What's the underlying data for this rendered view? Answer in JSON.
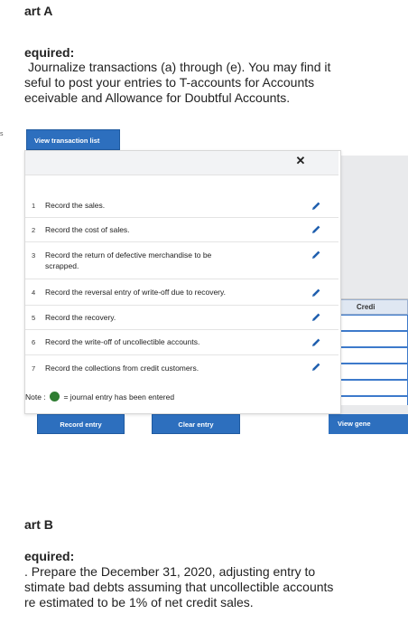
{
  "part_a": {
    "title": "art A",
    "required_label": "equired:",
    "lines": [
      "Journalize transactions (a) through (e). You may find it",
      "seful to post your entries to T-accounts for Accounts",
      "eceivable and Allowance for Doubtful Accounts."
    ]
  },
  "edge_marker": "s",
  "view_transaction_list": "View transaction list",
  "popup": {
    "close_symbol": "✕",
    "transactions": [
      {
        "num": "1",
        "text_lines": [
          "Record the sales."
        ]
      },
      {
        "num": "2",
        "text_lines": [
          "Record the cost of sales."
        ]
      },
      {
        "num": "3",
        "text_lines": [
          "Record the return of defective merchandise to be",
          "scrapped."
        ]
      },
      {
        "num": "4",
        "text_lines": [
          "Record the reversal entry of write-off due to recovery."
        ]
      },
      {
        "num": "5",
        "text_lines": [
          "Record the recovery."
        ]
      },
      {
        "num": "6",
        "text_lines": [
          "Record the write-off of uncollectible accounts."
        ]
      },
      {
        "num": "7",
        "text_lines": [
          "Record the collections from credit customers."
        ]
      }
    ],
    "note_prefix": "Note :",
    "note_suffix": "= journal entry has been entered",
    "record_entry": "Record entry",
    "clear_entry": "Clear entry"
  },
  "background": {
    "credit_header": "Credi",
    "view_general": "View gene"
  },
  "part_b": {
    "title": "art B",
    "required_label": "equired:",
    "lines": [
      ". Prepare the December 31, 2020, adjusting entry to",
      "stimate bad debts assuming that uncollectible accounts",
      "re estimated to be 1% of net credit sales."
    ]
  },
  "colors": {
    "accent": "#2d6fbe",
    "entered_dot": "#2f7d32",
    "pencil": "#1f5fae"
  }
}
